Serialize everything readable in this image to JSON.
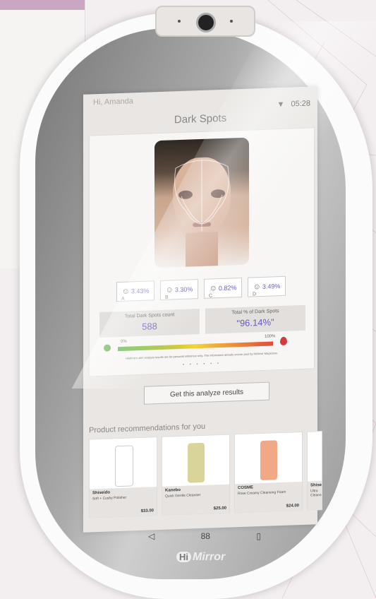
{
  "header": {
    "greeting": "Hi, Amanda",
    "time": "05:28",
    "title": "Dark Spots"
  },
  "chips": [
    {
      "letter": "A",
      "value": "3.43%"
    },
    {
      "letter": "B",
      "value": "3.30%"
    },
    {
      "letter": "C",
      "value": "0.82%"
    },
    {
      "letter": "D",
      "value": "3.49%"
    }
  ],
  "stats": {
    "count_label": "Total Dark Spots count",
    "count_value": "588",
    "percent_label": "Total % of Dark Spots",
    "percent_value": "\"96.14%\""
  },
  "scale": {
    "min_label": "0%",
    "max_label": "100%",
    "disclaimer": "HiMirror's skin analysis results are for personal reference only. The information already on/can post by HiMirror Magicians."
  },
  "pager_dots": "• • • • • •",
  "action": {
    "analyze_label": "Get this analyze results"
  },
  "recommendations": {
    "title": "Product recommendations for you",
    "products": [
      {
        "brand": "Shiseido",
        "name": "Soft + Cushy Polisher",
        "price": "$33.00",
        "color": "#ffffff"
      },
      {
        "brand": "Kanebo",
        "name": "Quick Gentle Cleanser",
        "price": "$25.00",
        "color": "#d8d49a"
      },
      {
        "brand": "COSME",
        "name": "Rose Creamy Cleansing Foam",
        "price": "$24.00",
        "color": "#f1a887"
      },
      {
        "brand": "Shise",
        "name": "Ultra Cleans",
        "price": "",
        "color": "#ffffff"
      }
    ]
  },
  "nav": {
    "back": "◁",
    "home": "88",
    "recent": "▯"
  },
  "brand": {
    "logo_badge": "Hi",
    "logo_text": "Mirror"
  }
}
